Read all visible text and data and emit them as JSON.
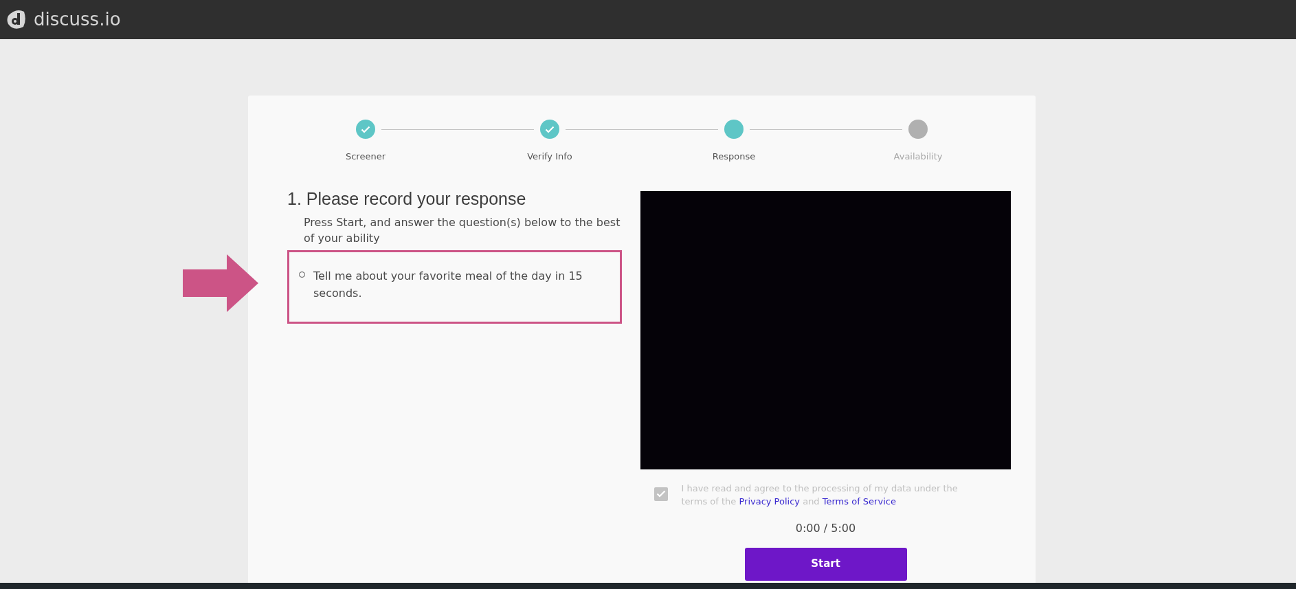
{
  "header": {
    "brand": "discuss.io"
  },
  "steps": [
    {
      "label": "Screener",
      "completed": true,
      "reached": true
    },
    {
      "label": "Verify Info",
      "completed": true,
      "reached": true
    },
    {
      "label": "Response",
      "completed": false,
      "reached": true
    },
    {
      "label": "Availability",
      "completed": false,
      "reached": false
    }
  ],
  "question": {
    "title": "1. Please record your response",
    "instructions": "Press Start, and answer the question(s) below to the best of your ability",
    "items": [
      "Tell me about your favorite meal of the day in 15 seconds."
    ]
  },
  "consent": {
    "checked": true,
    "parts": [
      {
        "kind": "text",
        "value": "I have read and agree to the processing of my data under the terms of the "
      },
      {
        "kind": "link",
        "value": "Privacy Policy"
      },
      {
        "kind": "text",
        "value": " and "
      },
      {
        "kind": "link",
        "value": "Terms of Service"
      }
    ]
  },
  "timer": "0:00 / 5:00",
  "start_button": "Start"
}
